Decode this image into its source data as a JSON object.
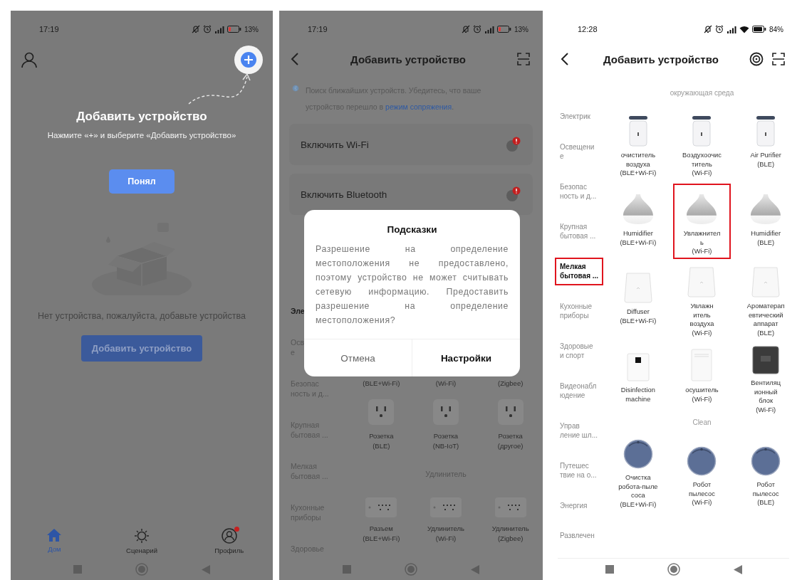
{
  "home_screen": {
    "status_bar": {
      "time": "17:19",
      "battery": "13%",
      "battery_low": true,
      "wifi": false
    },
    "guide": {
      "title": "Добавить устройство",
      "hint": "Нажмите «+» и выберите «Добавить устройство»",
      "button": "Понял"
    },
    "empty_state": {
      "message": "Нет устройства, пожалуйста, добавьте устройства",
      "button": "Добавить устройство"
    },
    "tabs": [
      {
        "label": "Дом",
        "selected": true,
        "notification": false
      },
      {
        "label": "Сценарий",
        "selected": false,
        "notification": false
      },
      {
        "label": "Профиль",
        "selected": false,
        "notification": true
      }
    ]
  },
  "pairing_screen": {
    "status_bar": {
      "time": "17:19",
      "battery": "13%",
      "battery_low": true,
      "wifi": false
    },
    "title": "Добавить устройство",
    "notice": {
      "text": "Поиск ближайших устройств. Убедитесь, что ваше устройство перешло в",
      "link": "режим сопряжения",
      "tail": "."
    },
    "toggles": [
      {
        "label": "Включить Wi-Fi",
        "alert": true
      },
      {
        "label": "Включить Bluetooth",
        "alert": true
      }
    ],
    "categories": [
      {
        "label": "Эле",
        "selected": true
      },
      {
        "label": "Осв\nе",
        "selected": false
      },
      {
        "label": "Безопас\nность и д...",
        "selected": false
      },
      {
        "label": "Крупная\nбытовая ...",
        "selected": false
      },
      {
        "label": "Мелкая\nбытовая ...",
        "selected": false
      },
      {
        "label": "Кухонные\nприборы",
        "selected": false
      },
      {
        "label": "Здоровье",
        "selected": false
      }
    ],
    "sections": [
      {
        "devices": [
          {
            "name": "(BLE+Wi-Fi)",
            "kind": "hidden"
          },
          {
            "name": "(Wi-Fi)",
            "kind": "hidden"
          },
          {
            "name": "(Zigbee)",
            "kind": "hidden"
          },
          {
            "name": "Розетка\n(BLE)",
            "kind": "socket"
          },
          {
            "name": "Розетка\n(NB-IoT)",
            "kind": "socket"
          },
          {
            "name": "Розетка\n(другое)",
            "kind": "socket"
          }
        ]
      },
      {
        "title": "Удлинитель",
        "devices": [
          {
            "name": "Разъем\n(BLE+Wi-Fi)",
            "kind": "power-strip"
          },
          {
            "name": "Удлинитель\n(Wi-Fi)",
            "kind": "power-strip"
          },
          {
            "name": "Удлинитель\n(Zigbee)",
            "kind": "power-strip"
          }
        ]
      }
    ],
    "dialog": {
      "title": "Подсказки",
      "message": "Разрешение на определение местоположения не предоставлено, поэтому устройство не может считывать сетевую информацию. Предоставить разрешение на определение местоположения?",
      "buttons": [
        {
          "label": "Отмена",
          "primary": false
        },
        {
          "label": "Настройки",
          "primary": true
        }
      ]
    }
  },
  "catalog_screen": {
    "status_bar": {
      "time": "12:28",
      "battery": "84%",
      "battery_low": false,
      "wifi": true
    },
    "title": "Добавить устройство",
    "categories": [
      {
        "label": "Электрик",
        "selected": false,
        "highlighted": false
      },
      {
        "label": "Освещени\nе",
        "selected": false,
        "highlighted": false
      },
      {
        "label": "Безопас\nность и д...",
        "selected": false,
        "highlighted": false
      },
      {
        "label": "Крупная\nбытовая ...",
        "selected": false,
        "highlighted": false
      },
      {
        "label": "Мелкая\nбытовая ...",
        "selected": true,
        "highlighted": true
      },
      {
        "label": "Кухонные\nприборы",
        "selected": false,
        "highlighted": false
      },
      {
        "label": "Здоровые\nи спорт",
        "selected": false,
        "highlighted": false
      },
      {
        "label": "Видеонабл\nюдение",
        "selected": false,
        "highlighted": false
      },
      {
        "label": "Управ\nление шл...",
        "selected": false,
        "highlighted": false
      },
      {
        "label": "Путешес\nтвие на о...",
        "selected": false,
        "highlighted": false
      },
      {
        "label": "Энергия",
        "selected": false,
        "highlighted": false
      },
      {
        "label": "Развлечен",
        "selected": false,
        "highlighted": false
      }
    ],
    "sections": [
      {
        "title": "окружающая среда",
        "devices": [
          {
            "name": "очиститель\nвоздуха\n(BLE+Wi-Fi)",
            "kind": "purifier",
            "highlighted": false
          },
          {
            "name": "Воздухоочис\nтитель\n(Wi-Fi)",
            "kind": "purifier",
            "highlighted": false
          },
          {
            "name": "Air Purifier\n(BLE)",
            "kind": "purifier",
            "highlighted": false
          },
          {
            "name": "Humidifier\n(BLE+Wi-Fi)",
            "kind": "humidifier",
            "highlighted": false
          },
          {
            "name": "Увлажнител\nь\n(Wi-Fi)",
            "kind": "humidifier",
            "highlighted": true
          },
          {
            "name": "Humidifier\n(BLE)",
            "kind": "humidifier",
            "highlighted": false
          },
          {
            "name": "Diffuser\n(BLE+Wi-Fi)",
            "kind": "diffuser",
            "highlighted": false
          },
          {
            "name": "Увлажн\nитель\nвоздуха\n(Wi-Fi)",
            "kind": "diffuser",
            "highlighted": false
          },
          {
            "name": "Ароматерап\nевтический\nаппарат\n(BLE)",
            "kind": "diffuser",
            "highlighted": false
          },
          {
            "name": "Disinfection\nmachine",
            "kind": "disinfector",
            "highlighted": false
          },
          {
            "name": "осушитель\n(Wi-Fi)",
            "kind": "dehumidifier",
            "highlighted": false
          },
          {
            "name": "Вентиляц\nионный\nблок\n(Wi-Fi)",
            "kind": "ventilation",
            "highlighted": false
          }
        ]
      },
      {
        "title": "Clean",
        "devices": [
          {
            "name": "Очистка\nробота-пыле\nсоса\n(BLE+Wi-Fi)",
            "kind": "robot",
            "highlighted": false
          },
          {
            "name": "Робот\nпылесос\n(Wi-Fi)",
            "kind": "robot",
            "highlighted": false
          },
          {
            "name": "Робот\nпылесос\n(BLE)",
            "kind": "robot",
            "highlighted": false
          }
        ]
      }
    ]
  }
}
